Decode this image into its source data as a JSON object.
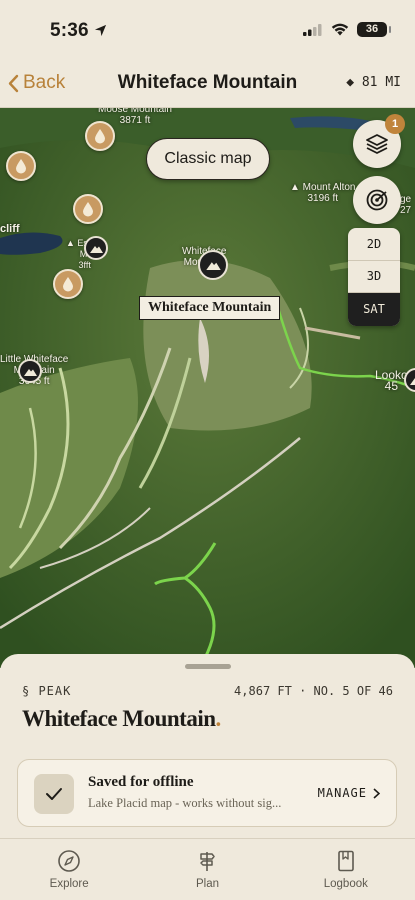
{
  "status": {
    "time": "5:36",
    "battery": "36"
  },
  "nav": {
    "back_label": "Back",
    "title": "Whiteface Mountain",
    "distance": "◆ 81 MI"
  },
  "map": {
    "classic_button": "Classic map",
    "layers_badge": "1",
    "modes": [
      "2D",
      "3D",
      "SAT"
    ],
    "active_mode": "SAT",
    "callout": "Whiteface Mountain",
    "labels": {
      "moose": "Moose Mountain\n3871 ft",
      "alton": "▲ Mount Alton\n3196 ft",
      "alton_right": "ge\n27",
      "cliff": "cliff",
      "esther": "▲ Esther\nMt\n3fft",
      "whiteface": "Whiteface\nMountain",
      "little": "Little Whiteface\nMountain\n3645 ft",
      "lookout": "Looko\n45"
    }
  },
  "sheet": {
    "type": "§ PEAK",
    "meta": "4,867 FT · NO. 5 OF 46",
    "name": "Whiteface Mountain",
    "name_dot": ".",
    "offline_title": "Saved for offline",
    "offline_sub": "Lake Placid map - works without sig...",
    "manage": "MANAGE"
  },
  "tabs": [
    {
      "label": "Explore",
      "icon": "compass-icon"
    },
    {
      "label": "Plan",
      "icon": "signpost-icon"
    },
    {
      "label": "Logbook",
      "icon": "book-icon"
    }
  ],
  "colors": {
    "accent": "#b8823a",
    "background": "#efe9dc",
    "trail": "#7cd44c",
    "pin": "#c89a62"
  }
}
